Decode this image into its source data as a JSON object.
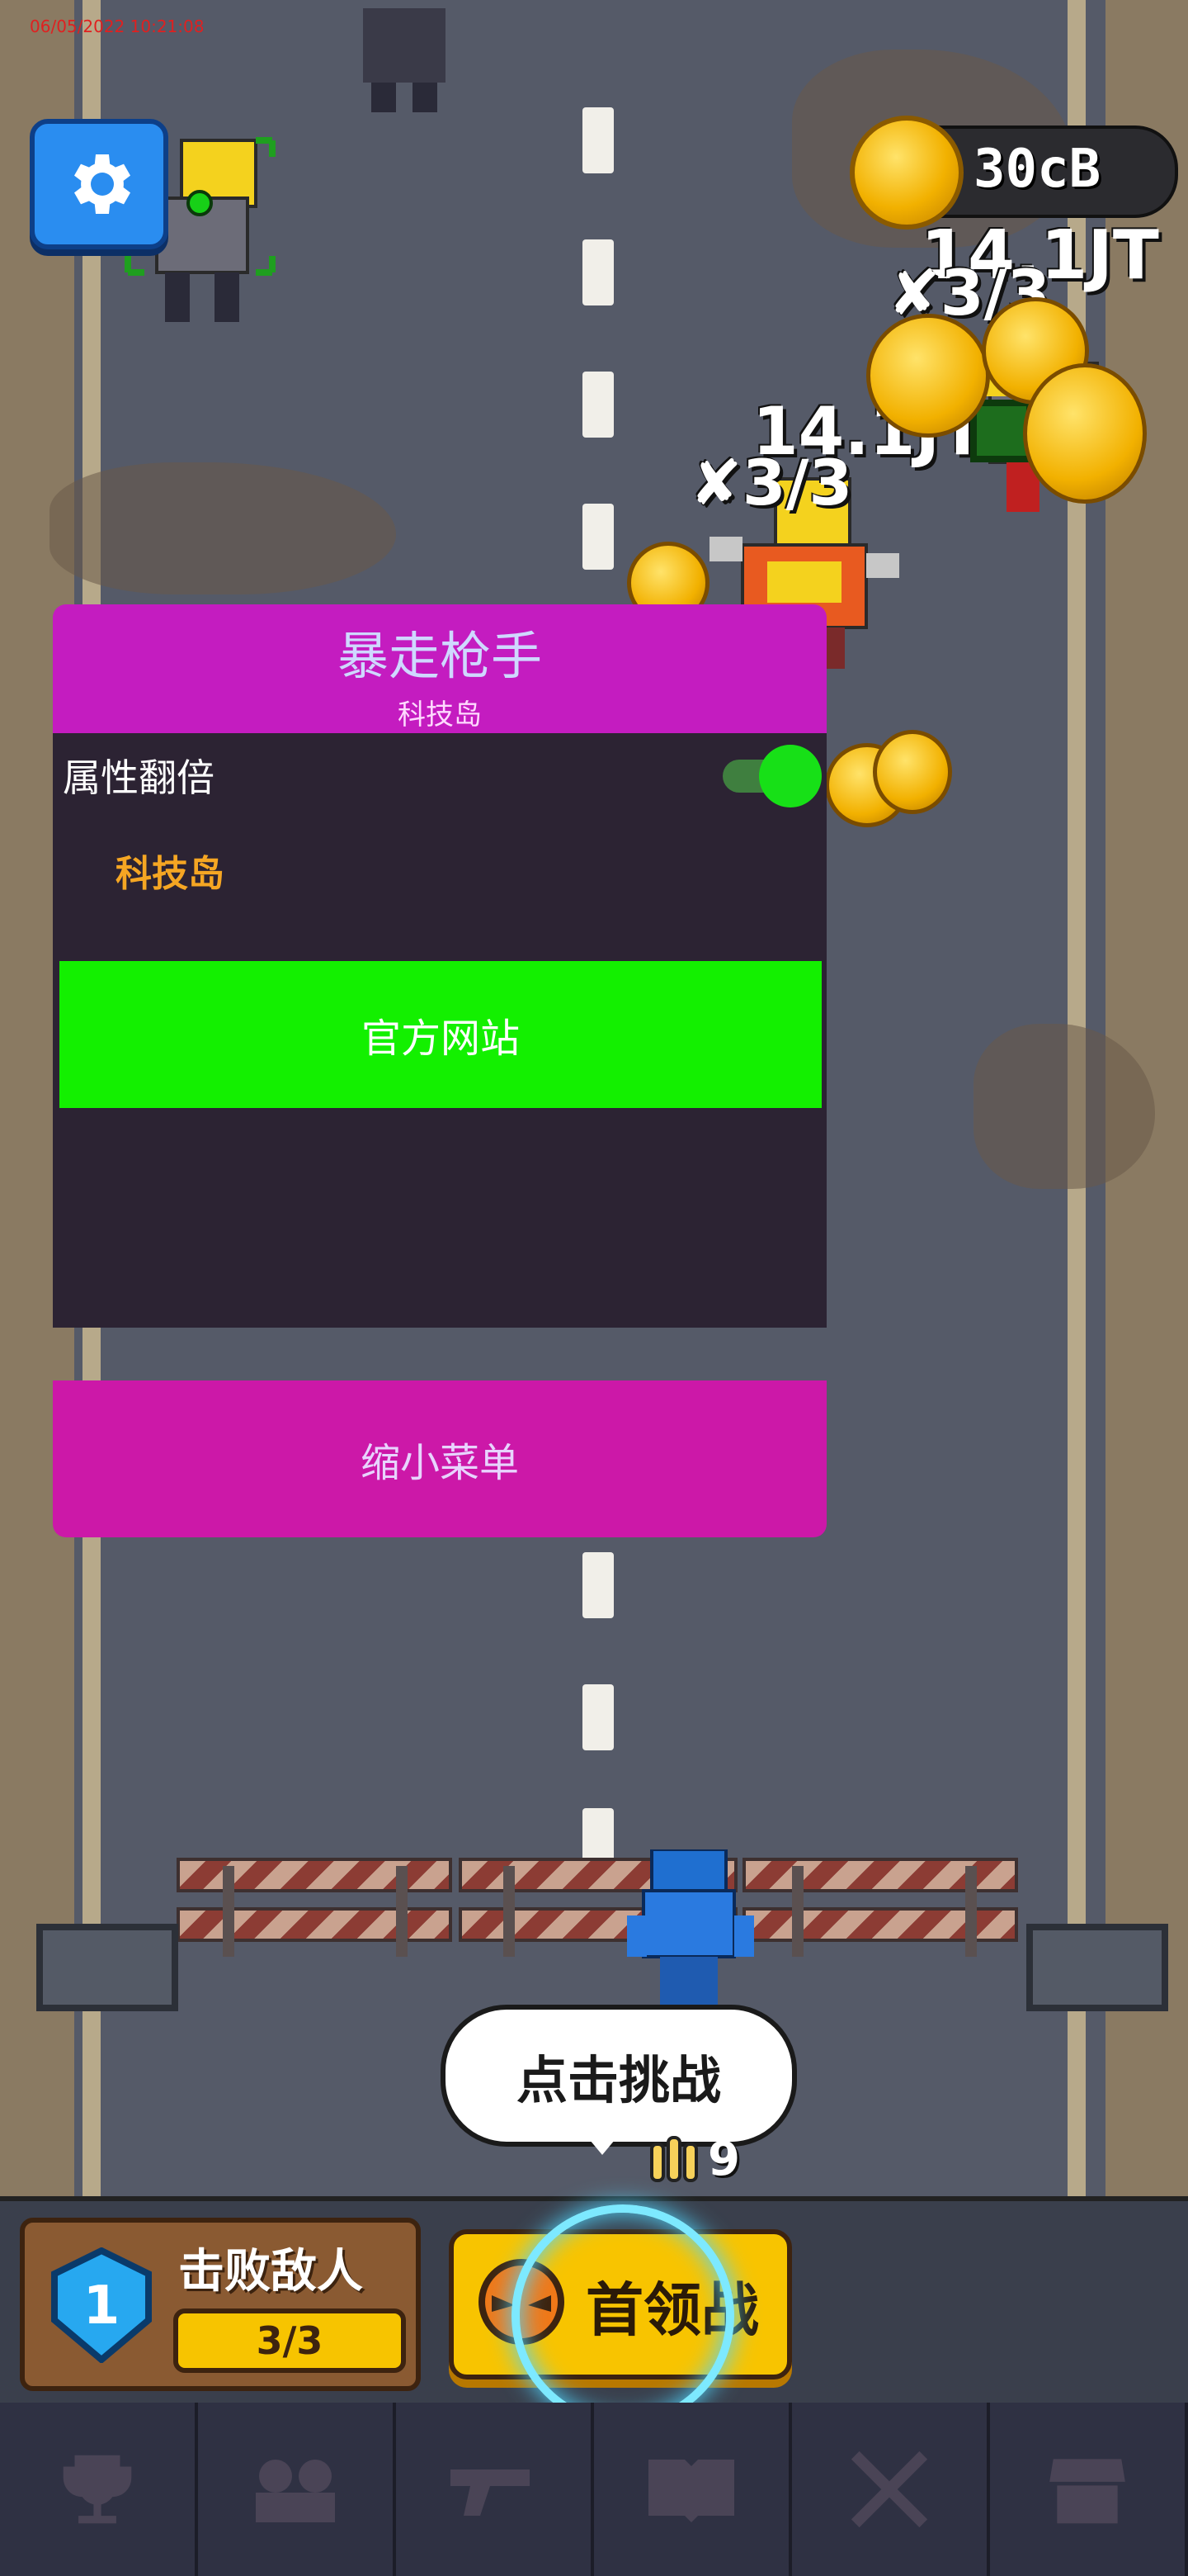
{
  "status_bar": {
    "timestamp": "06/05/2022 10:21:08"
  },
  "hud": {
    "coins": "30cB"
  },
  "enemies": [
    {
      "health": "14.1JT",
      "kills": "3/3"
    },
    {
      "health": "14.1JT",
      "kills": "3/3"
    }
  ],
  "menu": {
    "title": "暴走枪手",
    "subtitle": "科技岛",
    "toggle_label": "属性翻倍",
    "toggle_on": true,
    "orange_label": "科技岛",
    "website_button": "官方网站",
    "collapse_button": "缩小菜单"
  },
  "tooltip": {
    "text": "点击挑战"
  },
  "ammo": {
    "count": "9"
  },
  "quest": {
    "level": "1",
    "title": "击败敌人",
    "progress": "3/3"
  },
  "boss_button": {
    "label": "首领战"
  },
  "nav": {
    "items": [
      {
        "icon": "trophy-icon"
      },
      {
        "icon": "characters-icon"
      },
      {
        "icon": "gun-icon"
      },
      {
        "icon": "book-icon"
      },
      {
        "icon": "crossed-swords-icon"
      },
      {
        "icon": "shop-icon"
      }
    ]
  },
  "colors": {
    "menu_header": "#c41cc0",
    "menu_body": "#2c2333",
    "green_button": "#13f000",
    "coin": "#f2b100",
    "toggle_on": "#17e017"
  }
}
